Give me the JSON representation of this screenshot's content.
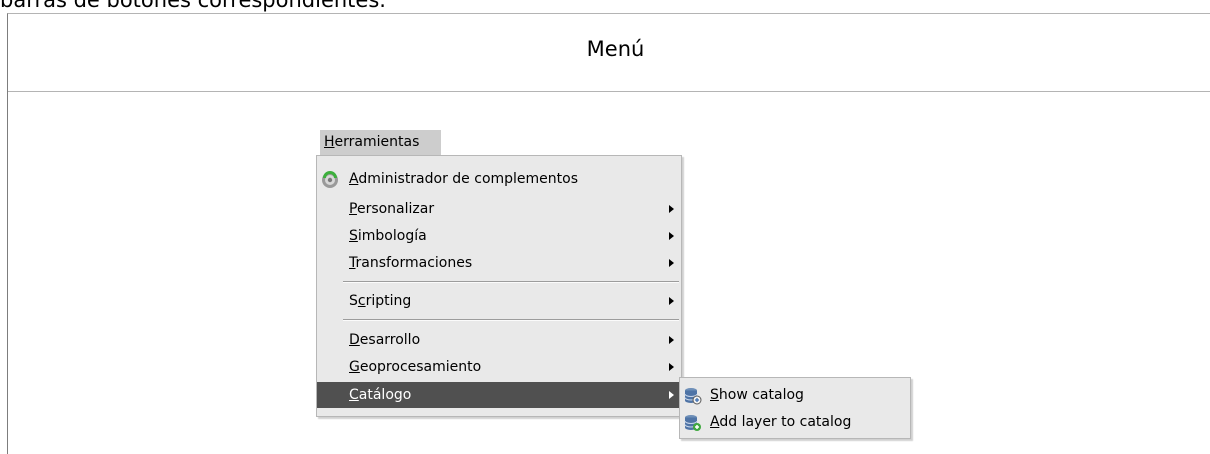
{
  "document": {
    "caption_fragment": "barras de botones correspondientes.",
    "table_header": "Menú"
  },
  "menubar": {
    "active_menu": "Herramientas",
    "accelerator": "H"
  },
  "menu": {
    "items": [
      {
        "label": "Administrador de complementos",
        "accel": "A",
        "icon": "addon-manager-icon",
        "has_submenu": false
      },
      {
        "label": "Personalizar",
        "accel": "P",
        "has_submenu": true
      },
      {
        "label": "Simbología",
        "accel": "S",
        "has_submenu": true
      },
      {
        "label": "Transformaciones",
        "accel": "T",
        "has_submenu": true
      },
      {
        "label": "Scripting",
        "accel": "c",
        "has_submenu": true
      },
      {
        "label": "Desarrollo",
        "accel": "D",
        "has_submenu": true
      },
      {
        "label": "Geoprocesamiento",
        "accel": "G",
        "has_submenu": true
      },
      {
        "label": "Catálogo",
        "accel": "C",
        "has_submenu": true,
        "highlighted": true
      }
    ]
  },
  "submenu": {
    "items": [
      {
        "label": "Show catalog",
        "accel": "S",
        "icon": "database-view-icon"
      },
      {
        "label": "Add layer to catalog",
        "accel": "A",
        "icon": "database-add-icon"
      }
    ]
  },
  "colors": {
    "menu_bg": "#e9e9e9",
    "highlight_bg": "#505050",
    "menubar_active_bg": "#cdcdcd"
  }
}
